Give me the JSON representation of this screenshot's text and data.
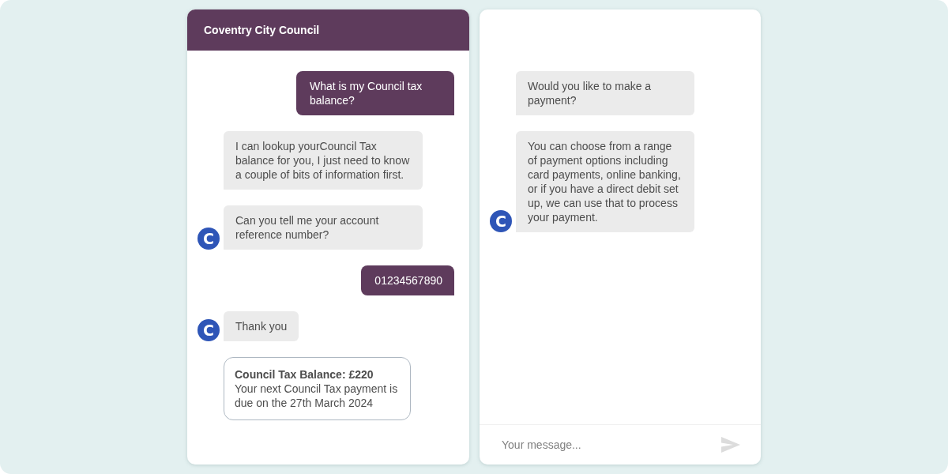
{
  "header": {
    "title": "Coventry City Council"
  },
  "chat": {
    "messages": [
      {
        "kind": "user",
        "text": "What is my Council tax balance?"
      },
      {
        "kind": "bot",
        "text": "I can lookup yourCouncil Tax balance for you, I just need to know a couple of bits of information first."
      },
      {
        "kind": "bot",
        "text": "Can you tell me your account reference number?",
        "avatar": "C"
      },
      {
        "kind": "user",
        "text": "01234567890"
      },
      {
        "kind": "bot",
        "text": "Thank you",
        "avatar": "C"
      },
      {
        "kind": "card",
        "title": "Council Tax Balance: £220",
        "text": "Your next Council Tax payment is due on the 27th March 2024"
      }
    ]
  },
  "chat_continued": {
    "messages": [
      {
        "kind": "bot",
        "text": "Would you like to make a payment?"
      },
      {
        "kind": "bot",
        "text": "You can choose from a range of payment options including card payments, online banking, or if you have a direct debit set up, we can use that to process your payment.",
        "avatar": "C"
      }
    ],
    "composer": {
      "placeholder": "Your message...",
      "send_disabled": true
    }
  }
}
